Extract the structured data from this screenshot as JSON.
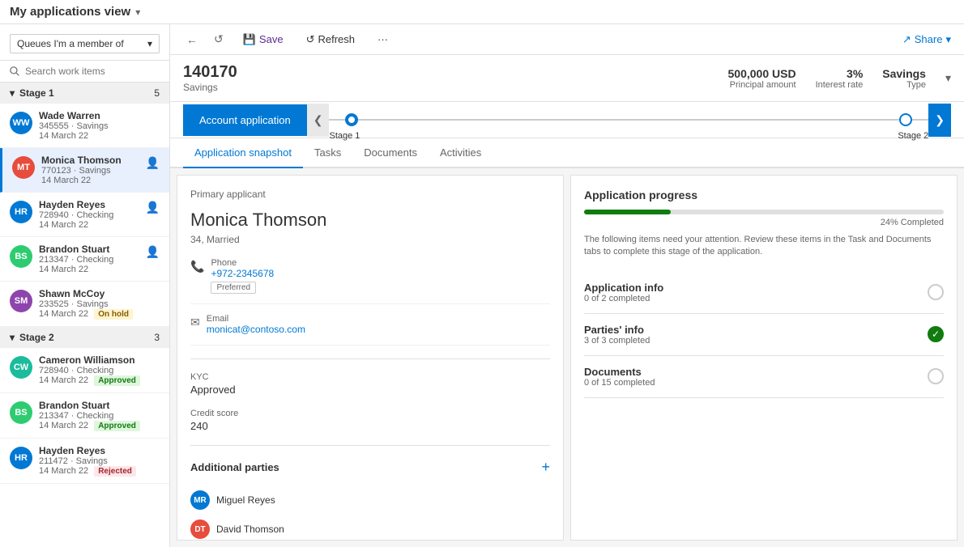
{
  "topbar": {
    "title": "My applications view",
    "chevron": "▾"
  },
  "sidebar": {
    "queue_label": "Queues I'm a member of",
    "queue_chevron": "▾",
    "search_placeholder": "Search work items",
    "stage1": {
      "label": "Stage 1",
      "count": "5",
      "items": [
        {
          "initials": "WW",
          "color": "#0078d4",
          "name": "Wade Warren",
          "id": "345555",
          "type": "Savings",
          "date": "14 March 22",
          "badge": "",
          "has_person_icon": false
        },
        {
          "initials": "MT",
          "color": "#e74c3c",
          "name": "Monica Thomson",
          "id": "770123",
          "type": "Savings",
          "date": "14 March 22",
          "badge": "",
          "has_person_icon": true,
          "active": true
        },
        {
          "initials": "HR",
          "color": "#0078d4",
          "name": "Hayden Reyes",
          "id": "728940",
          "type": "Checking",
          "date": "14 March 22",
          "badge": "",
          "has_person_icon": true
        },
        {
          "initials": "BS",
          "color": "#2ecc71",
          "name": "Brandon Stuart",
          "id": "213347",
          "type": "Checking",
          "date": "14 March 22",
          "badge": "",
          "has_person_icon": true
        },
        {
          "initials": "SM",
          "color": "#8e44ad",
          "name": "Shawn McCoy",
          "id": "233525",
          "type": "Savings",
          "date": "14 March 22",
          "badge": "On hold",
          "badge_class": "badge-onhold",
          "has_person_icon": false
        }
      ]
    },
    "stage2": {
      "label": "Stage 2",
      "count": "3",
      "items": [
        {
          "initials": "CW",
          "color": "#1abc9c",
          "name": "Cameron Williamson",
          "id": "728940",
          "type": "Checking",
          "date": "14 March 22",
          "badge": "Approved",
          "badge_class": "badge-approved",
          "has_person_icon": false
        },
        {
          "initials": "BS",
          "color": "#2ecc71",
          "name": "Brandon Stuart",
          "id": "213347",
          "type": "Checking",
          "date": "14 March 22",
          "badge": "Approved",
          "badge_class": "badge-approved",
          "has_person_icon": false
        },
        {
          "initials": "HR",
          "color": "#0078d4",
          "name": "Hayden Reyes",
          "id": "211472",
          "type": "Savings",
          "date": "14 March 22",
          "badge": "Rejected",
          "badge_class": "badge-rejected",
          "has_person_icon": false
        }
      ]
    }
  },
  "toolbar": {
    "back_label": "←",
    "refresh_label": "↺",
    "save_label": "Save",
    "refresh_text": "Refresh",
    "more_label": "···",
    "share_label": "Share",
    "share_chevron": "▾"
  },
  "record": {
    "id": "140170",
    "type": "Savings",
    "principal_amount": "500,000 USD",
    "principal_label": "Principal amount",
    "interest_rate": "3%",
    "interest_label": "Interest rate",
    "savings_type": "Savings",
    "savings_label": "Type",
    "chevron": "▾"
  },
  "stages": {
    "stage_btn": "Account application",
    "left_arrow": "❮",
    "right_arrow": "❯",
    "stage1_label": "Stage 1",
    "stage2_label": "Stage 2"
  },
  "tabs": [
    "Application snapshot",
    "Tasks",
    "Documents",
    "Activities"
  ],
  "active_tab": 0,
  "applicant": {
    "section_label": "Primary applicant",
    "name": "Monica Thomson",
    "sub": "34, Married",
    "phone_label": "Phone",
    "phone": "+972-2345678",
    "phone_badge": "Preferred",
    "email_label": "Email",
    "email": "monicat@contoso.com",
    "kyc_label": "KYC",
    "kyc_value": "Approved",
    "credit_label": "Credit score",
    "credit_value": "240"
  },
  "additional_parties": {
    "title": "Additional parties",
    "add_btn": "+",
    "parties": [
      {
        "initials": "MR",
        "color": "#0078d4",
        "name": "Miguel Reyes"
      },
      {
        "initials": "DT",
        "color": "#e74c3c",
        "name": "David Thomson"
      }
    ]
  },
  "progress": {
    "title": "Application progress",
    "pct": 24,
    "pct_label": "24% Completed",
    "note": "The following items need your attention. Review these items in the Task and Documents tabs to complete this stage of the application.",
    "items": [
      {
        "name": "Application info",
        "sub": "0 of 2 completed",
        "done": false
      },
      {
        "name": "Parties' info",
        "sub": "3 of 3 completed",
        "done": true
      },
      {
        "name": "Documents",
        "sub": "0 of 15 completed",
        "done": false
      }
    ]
  }
}
